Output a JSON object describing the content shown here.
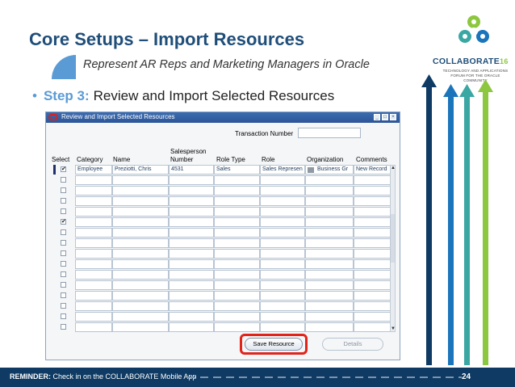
{
  "slide": {
    "title": "Core Setups – Import Resources",
    "subtitle": "Represent AR Reps and Marketing Managers in Oracle",
    "bullet_glyph": "•",
    "step_label": "Step 3:",
    "step_text": "Review and Import Selected Resources"
  },
  "logo": {
    "name": "COLLABORATE",
    "number": "16",
    "tagline": "TECHNOLOGY AND APPLICATIONS FORUM FOR THE ORACLE COMMUNITY"
  },
  "form": {
    "window_title": "Review and Import Selected Resources",
    "transaction_number_label": "Transaction Number",
    "transaction_number_value": "",
    "columns": {
      "select": "Select",
      "category": "Category",
      "name": "Name",
      "salesperson_line1": "Salesperson",
      "salesperson_line2": "Number",
      "role_type": "Role Type",
      "role": "Role",
      "organization": "Organization",
      "comments": "Comments"
    },
    "rows": [
      {
        "checked": "✔",
        "category": "Employee",
        "name": "Preziotti, Chris",
        "salesperson": "4531",
        "role_type": "Sales",
        "role": "Sales Represen",
        "organization": "Business Gr",
        "comments": "New Record"
      },
      {
        "checked": "",
        "category": "",
        "name": "",
        "salesperson": "",
        "role_type": "",
        "role": "",
        "organization": "",
        "comments": ""
      },
      {
        "checked": "",
        "category": "",
        "name": "",
        "salesperson": "",
        "role_type": "",
        "role": "",
        "organization": "",
        "comments": ""
      },
      {
        "checked": "",
        "category": "",
        "name": "",
        "salesperson": "",
        "role_type": "",
        "role": "",
        "organization": "",
        "comments": ""
      },
      {
        "checked": "",
        "category": "",
        "name": "",
        "salesperson": "",
        "role_type": "",
        "role": "",
        "organization": "",
        "comments": ""
      },
      {
        "checked": "✔",
        "category": "",
        "name": "",
        "salesperson": "",
        "role_type": "",
        "role": "",
        "organization": "",
        "comments": ""
      },
      {
        "checked": "",
        "category": "",
        "name": "",
        "salesperson": "",
        "role_type": "",
        "role": "",
        "organization": "",
        "comments": ""
      },
      {
        "checked": "",
        "category": "",
        "name": "",
        "salesperson": "",
        "role_type": "",
        "role": "",
        "organization": "",
        "comments": ""
      },
      {
        "checked": "",
        "category": "",
        "name": "",
        "salesperson": "",
        "role_type": "",
        "role": "",
        "organization": "",
        "comments": ""
      },
      {
        "checked": "",
        "category": "",
        "name": "",
        "salesperson": "",
        "role_type": "",
        "role": "",
        "organization": "",
        "comments": ""
      },
      {
        "checked": "",
        "category": "",
        "name": "",
        "salesperson": "",
        "role_type": "",
        "role": "",
        "organization": "",
        "comments": ""
      },
      {
        "checked": "",
        "category": "",
        "name": "",
        "salesperson": "",
        "role_type": "",
        "role": "",
        "organization": "",
        "comments": ""
      },
      {
        "checked": "",
        "category": "",
        "name": "",
        "salesperson": "",
        "role_type": "",
        "role": "",
        "organization": "",
        "comments": ""
      },
      {
        "checked": "",
        "category": "",
        "name": "",
        "salesperson": "",
        "role_type": "",
        "role": "",
        "organization": "",
        "comments": ""
      },
      {
        "checked": "",
        "category": "",
        "name": "",
        "salesperson": "",
        "role_type": "",
        "role": "",
        "organization": "",
        "comments": ""
      },
      {
        "checked": "",
        "category": "",
        "name": "",
        "salesperson": "",
        "role_type": "",
        "role": "",
        "organization": "",
        "comments": ""
      }
    ],
    "save_button": "Save Resource",
    "details_button": "Details"
  },
  "footer": {
    "reminder_label": "REMINDER:",
    "reminder_text": "Check in on the COLLABORATE Mobile App",
    "page_number": "24"
  },
  "colors": {
    "title": "#1f4e79",
    "accent": "#5b9bd5",
    "highlight_ring": "#e2231a",
    "footer_bg": "#0e3a63",
    "arrow_green": "#8dc63f",
    "arrow_blue": "#1b75bb",
    "arrow_teal": "#3aa7a3",
    "arrow_navy": "#0e3a63"
  }
}
